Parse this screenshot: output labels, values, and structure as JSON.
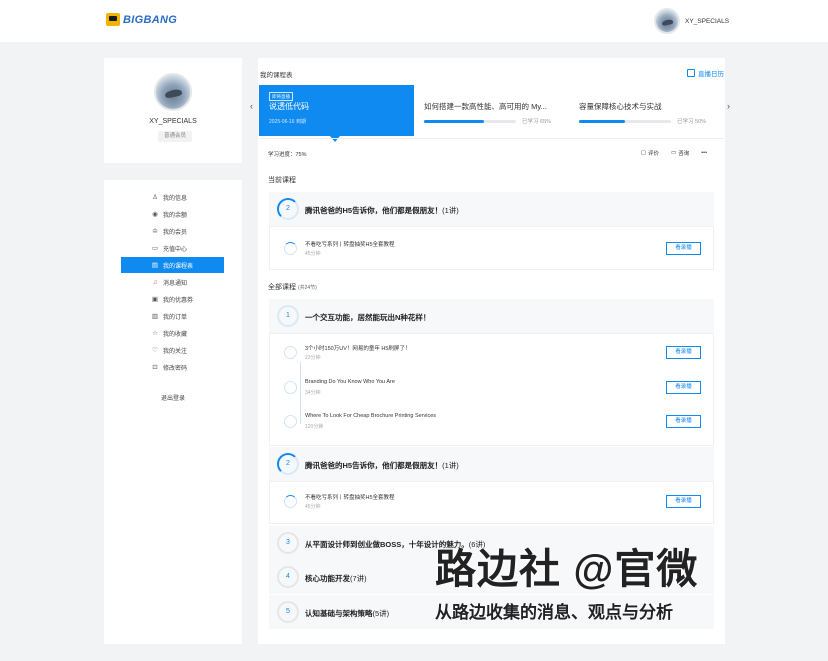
{
  "header": {
    "logo_text": "BIGBANG",
    "username": "XY_SPECIALS"
  },
  "profile": {
    "username": "XY_SPECIALS",
    "member_badge": "普通会员"
  },
  "menu": {
    "items": [
      {
        "icon": "user-icon",
        "glyph": "♙",
        "label": "我的信息"
      },
      {
        "icon": "coin-icon",
        "glyph": "◉",
        "label": "我的余额"
      },
      {
        "icon": "crown-icon",
        "glyph": "♔",
        "label": "我的会员"
      },
      {
        "icon": "card-icon",
        "glyph": "▭",
        "label": "充值中心"
      },
      {
        "icon": "schedule-icon",
        "glyph": "▤",
        "label": "我的课程表"
      },
      {
        "icon": "bell-icon",
        "glyph": "♫",
        "label": "消息通知"
      },
      {
        "icon": "coupon-icon",
        "glyph": "▣",
        "label": "我的优惠券"
      },
      {
        "icon": "order-icon",
        "glyph": "▥",
        "label": "我的订单"
      },
      {
        "icon": "star-icon",
        "glyph": "☆",
        "label": "我的收藏"
      },
      {
        "icon": "heart-icon",
        "glyph": "♡",
        "label": "我的关注"
      },
      {
        "icon": "lock-icon",
        "glyph": "⊡",
        "label": "修改密码"
      }
    ],
    "active_index": 4,
    "logout": "退出登录"
  },
  "schedule": {
    "title": "我的课程表",
    "calendar_link": "直播日历",
    "active_card": {
      "tag": "即将直播",
      "title": "说透低代码",
      "date": "2025-06-16 到期"
    },
    "cards": [
      {
        "title": "如何搭建一款高性能、高可用的 My...",
        "progress": 0.65,
        "progress_text": "已学习 65%"
      },
      {
        "title": "容量保障核心技术与实战",
        "progress": 0.5,
        "progress_text": "已学习 50%"
      }
    ],
    "progress_label": "学习进度：75%",
    "actions": {
      "review": "评价",
      "consult": "咨询",
      "more": "•••"
    }
  },
  "current": {
    "heading": "当前课程",
    "chapter": {
      "num": "2",
      "title": "腾讯爸爸的H5告诉你，他们都是假朋友！",
      "count": "(1讲)"
    },
    "lessons": [
      {
        "title": "不看吃亏系列丨转盘抽奖H5全套教程",
        "duration": "45分钟",
        "button": "看录播"
      }
    ]
  },
  "all": {
    "heading": "全部课程",
    "count": "(共24节)",
    "chapters": [
      {
        "num": "1",
        "title": "一个交互功能，居然能玩出N种花样！",
        "count": ""
      },
      {
        "num": "2",
        "title": "腾讯爸爸的H5告诉你，他们都是假朋友！",
        "count": "(1讲)"
      },
      {
        "num": "3",
        "title": "从平面设计师到创业做BOSS，十年设计的魅力。",
        "count": "(6讲)"
      },
      {
        "num": "4",
        "title": "核心功能开发",
        "count": "(7讲)"
      },
      {
        "num": "5",
        "title": "认知基础与架构策略",
        "count": "(5讲)"
      }
    ],
    "chapter1_lessons": [
      {
        "title": "3个小时150万UV！网易的童年 H5刷屏了！",
        "duration": "23分钟",
        "button": "看录播"
      },
      {
        "title": "Branding Do You Know Who You Are",
        "duration": "34分钟",
        "button": "看录播"
      },
      {
        "title": "Where To Look For Cheap Brochure Printing Services",
        "duration": "120分钟",
        "button": "看录播"
      }
    ],
    "chapter2_lessons": [
      {
        "title": "不看吃亏系列丨转盘抽奖H5全套教程",
        "duration": "45分钟",
        "button": "看录播"
      }
    ]
  },
  "watermark": {
    "line1": "路边社 @官微",
    "line2": "从路边收集的消息、观点与分析"
  },
  "colors": {
    "accent": "#0f8af0",
    "background": "#f2f3f5"
  }
}
